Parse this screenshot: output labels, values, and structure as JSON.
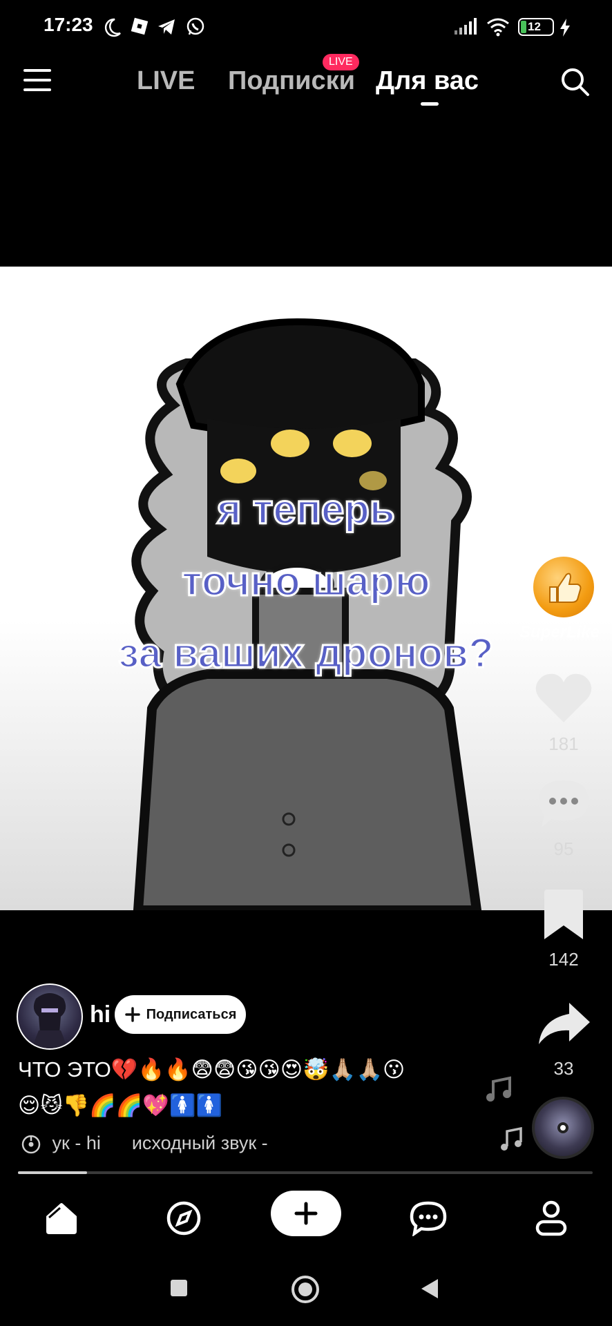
{
  "status_bar": {
    "time": "17:23",
    "battery": "12"
  },
  "top_nav": {
    "tabs": [
      "LIVE",
      "Подписки",
      "Для вас"
    ],
    "active_tab": "Для вас",
    "live_badge": "LIVE"
  },
  "video": {
    "overlay_lines": [
      "я теперь",
      "точно шарю",
      "за ваших дронов?"
    ]
  },
  "actions": {
    "superlike_label": "SuperLike",
    "likes": "181",
    "comments": "95",
    "saves": "142",
    "shares": "33"
  },
  "author": {
    "name": "hi",
    "follow_label": "Подписаться"
  },
  "caption": {
    "line1": "ЧТО ЭТО💔🔥🔥😨😨😘😘😍🤯🙏🏼🙏🏼😗",
    "line2": "😌😼👎🌈🌈💖🚺🚺"
  },
  "sound": {
    "text": "ук - hi      исходный звук -"
  },
  "progress": {
    "fraction": 0.12
  },
  "colors": {
    "accent_live": "#ff2a5f",
    "overlay_text": "#5860c6",
    "superlike": "#f39c12"
  }
}
